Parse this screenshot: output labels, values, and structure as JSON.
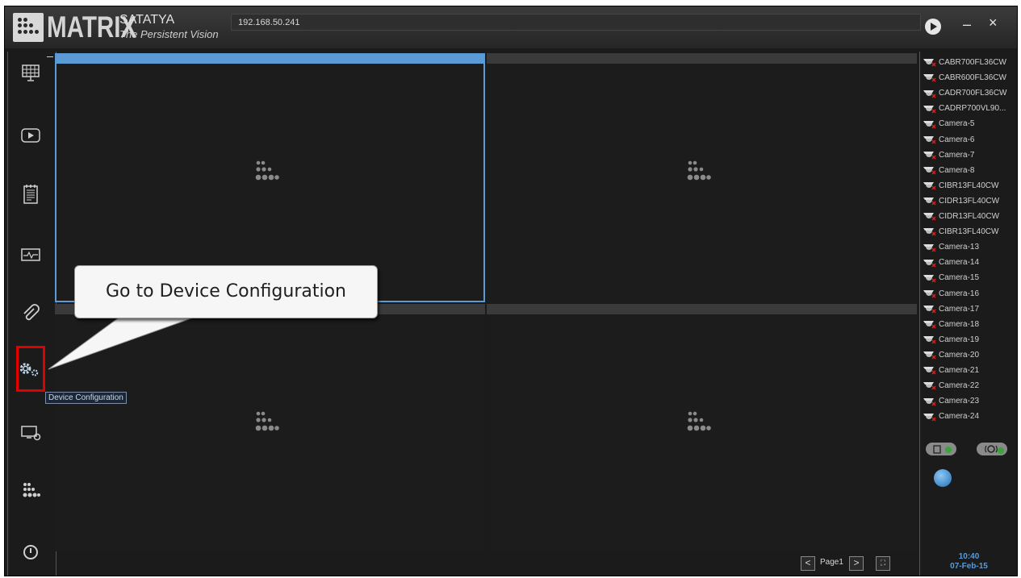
{
  "header": {
    "logo_text": "MATRIX",
    "brand": "SATATYA",
    "tagline": "The Persistent Vision",
    "address": "192.168.50.241",
    "play_icon": "play-circle-icon",
    "minimize_label": "–",
    "close_label": "×"
  },
  "sidebar": {
    "items": [
      {
        "name": "video-wall-icon"
      },
      {
        "name": "playback-icon"
      },
      {
        "name": "event-log-icon"
      },
      {
        "name": "health-status-icon"
      },
      {
        "name": "attachment-icon"
      },
      {
        "name": "device-configuration-icon"
      },
      {
        "name": "display-settings-icon"
      },
      {
        "name": "matrix-logo-icon"
      },
      {
        "name": "power-icon"
      }
    ],
    "tooltip": "Device Configuration"
  },
  "callout": {
    "text": "Go to Device Configuration"
  },
  "cameras": [
    "CABR700FL36CW",
    "CABR600FL36CW",
    "CADR700FL36CW",
    "CADRP700VL90...",
    "Camera-5",
    "Camera-6",
    "Camera-7",
    "Camera-8",
    "CIBR13FL40CW",
    "CIDR13FL40CW",
    "CIDR13FL40CW",
    "CIBR13FL40CW",
    "Camera-13",
    "Camera-14",
    "Camera-15",
    "Camera-16",
    "Camera-17",
    "Camera-18",
    "Camera-19",
    "Camera-20",
    "Camera-21",
    "Camera-22",
    "Camera-23",
    "Camera-24"
  ],
  "pager": {
    "page_label": "Page1",
    "prev_label": "<",
    "next_label": ">"
  },
  "clock": {
    "time": "10:40",
    "date": "07-Feb-15"
  },
  "colors": {
    "accent": "#5b9bd5",
    "highlight": "#e00000",
    "background": "#1b1b1b"
  }
}
